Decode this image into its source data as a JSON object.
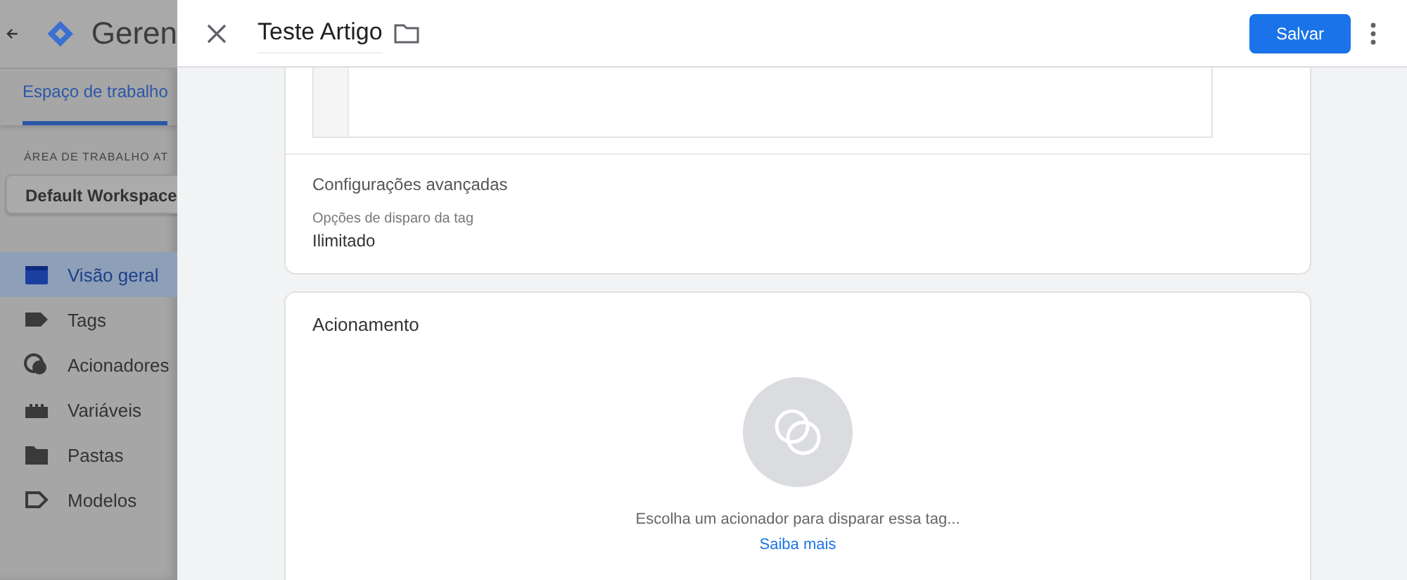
{
  "app": {
    "title": "Geren",
    "tabs": [
      {
        "label": "Espaço de trabalho",
        "selected": true
      }
    ],
    "workspace_label": "ÁREA DE TRABALHO AT",
    "workspace": "Default Workspace",
    "nav": [
      {
        "label": "Visão geral",
        "selected": true
      },
      {
        "label": "Tags",
        "selected": false
      },
      {
        "label": "Acionadores",
        "selected": false
      },
      {
        "label": "Variáveis",
        "selected": false
      },
      {
        "label": "Pastas",
        "selected": false
      },
      {
        "label": "Modelos",
        "selected": false
      }
    ]
  },
  "panel": {
    "title": "Teste Artigo",
    "save_button": "Salvar",
    "advanced": {
      "heading": "Configurações avançadas",
      "field_label": "Opções de disparo da tag",
      "field_value": "Ilimitado"
    },
    "triggering": {
      "heading": "Acionamento",
      "hint": "Escolha um acionador para disparar essa tag...",
      "link": "Saiba mais"
    }
  }
}
